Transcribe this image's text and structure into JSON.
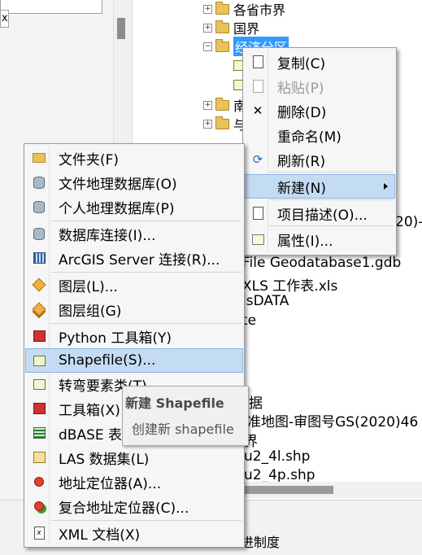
{
  "left_pane": {
    "fragment_char": "x"
  },
  "tree": {
    "items": [
      {
        "label": "各省市界",
        "expander": "+"
      },
      {
        "label": "国界",
        "expander": "+"
      },
      {
        "label": "经济分区",
        "expander": "−",
        "selected": true
      },
      {
        "label": "南",
        "expander": "+"
      },
      {
        "label": "与",
        "expander": "+"
      }
    ]
  },
  "background_list": [
    "20)-",
    "File Geodatabase1.gdb",
    "XLS 工作表.xls",
    "isDATA",
    "te",
    "据",
    "准地图-审图号GS(2020)46",
    "界",
    "u2_4l.shp",
    "u2_4p.shp"
  ],
  "status_bar": {
    "text": "进制度"
  },
  "context_menu": {
    "items": [
      {
        "label": "复制(C)",
        "icon": "copy-icon",
        "enabled": true
      },
      {
        "label": "粘贴(P)",
        "icon": "paste-icon",
        "enabled": false
      },
      {
        "label": "删除(D)",
        "icon": "delete-icon",
        "enabled": true
      },
      {
        "label": "重命名(M)",
        "icon": "",
        "enabled": true
      },
      {
        "label": "刷新(R)",
        "icon": "refresh-icon",
        "enabled": true
      },
      {
        "label": "新建(N)",
        "icon": "",
        "enabled": true,
        "has_submenu": true,
        "highlighted": true
      },
      {
        "label": "项目描述(O)...",
        "icon": "description-icon",
        "enabled": true
      },
      {
        "label": "属性(I)...",
        "icon": "properties-icon",
        "enabled": true
      }
    ]
  },
  "new_submenu": {
    "items": [
      {
        "label": "文件夹(F)",
        "icon": "folder-icon"
      },
      {
        "label": "文件地理数据库(O)",
        "icon": "file-geodatabase-icon"
      },
      {
        "label": "个人地理数据库(P)",
        "icon": "personal-geodatabase-icon"
      },
      {
        "label": "数据库连接(I)...",
        "icon": "database-connection-icon"
      },
      {
        "label": "ArcGIS Server 连接(R)...",
        "icon": "arcgis-server-icon"
      },
      {
        "label": "图层(L)...",
        "icon": "layer-icon"
      },
      {
        "label": "图层组(G)",
        "icon": "group-layer-icon"
      },
      {
        "label": "Python 工具箱(Y)",
        "icon": "python-toolbox-icon"
      },
      {
        "label": "Shapefile(S)...",
        "icon": "shapefile-icon",
        "highlighted": true
      },
      {
        "label": "转弯要素类(T)...",
        "icon": "turn-feature-class-icon"
      },
      {
        "label": "工具箱(X)",
        "icon": "toolbox-icon"
      },
      {
        "label": "dBASE 表",
        "icon": "dbase-table-icon"
      },
      {
        "label": "LAS 数据集(L)",
        "icon": "las-dataset-icon"
      },
      {
        "label": "地址定位器(A)...",
        "icon": "address-locator-icon"
      },
      {
        "label": "复合地址定位器(C)...",
        "icon": "composite-locator-icon"
      },
      {
        "label": "XML 文档(X)",
        "icon": "xml-document-icon"
      }
    ]
  },
  "tooltip": {
    "title": "新建 Shapefile",
    "description": "创建新 shapefile"
  }
}
